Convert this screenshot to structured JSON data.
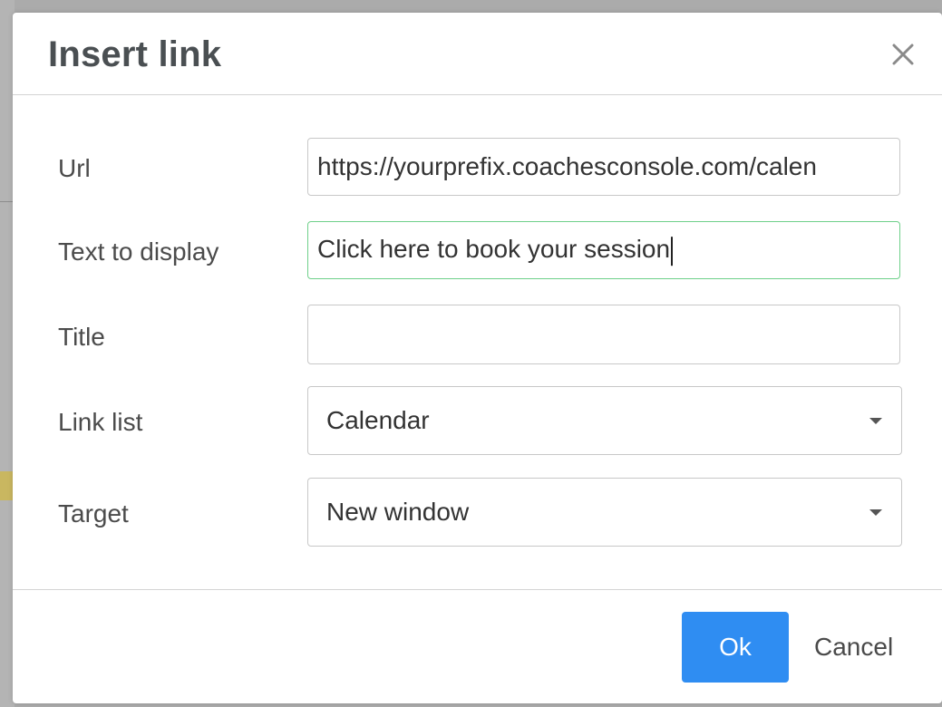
{
  "dialog": {
    "title": "Insert link",
    "close_icon": "close-icon"
  },
  "fields": {
    "url": {
      "label": "Url",
      "value": "https://yourprefix.coachesconsole.com/calen"
    },
    "text_to_display": {
      "label": "Text to display",
      "value": "Click here to book your session"
    },
    "title": {
      "label": "Title",
      "value": ""
    },
    "link_list": {
      "label": "Link list",
      "selected": "Calendar"
    },
    "target": {
      "label": "Target",
      "selected": "New window"
    }
  },
  "footer": {
    "ok_label": "Ok",
    "cancel_label": "Cancel"
  },
  "colors": {
    "primary_button": "#2f8df2",
    "focus_border": "#6fd08a"
  }
}
